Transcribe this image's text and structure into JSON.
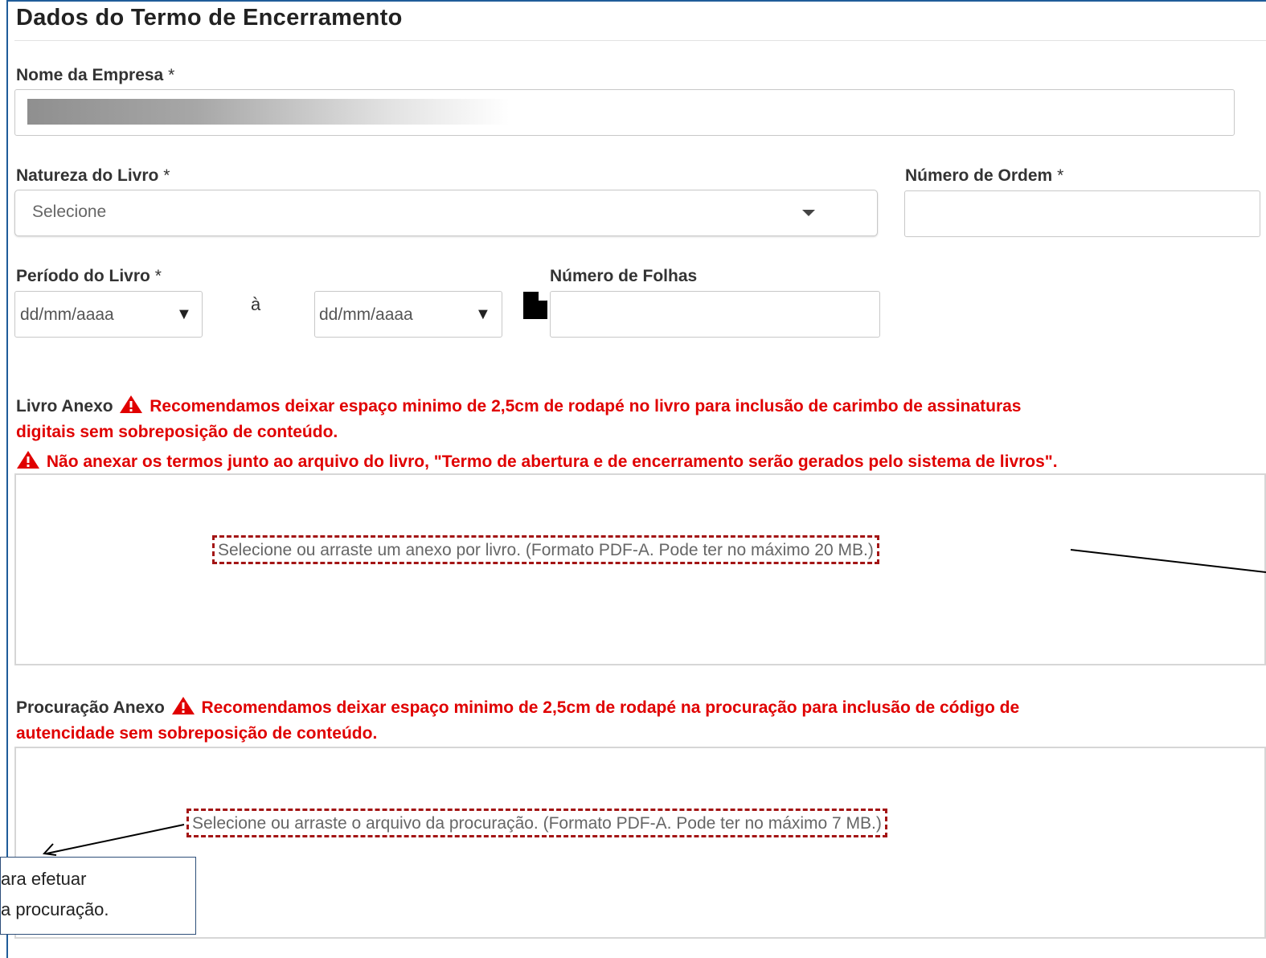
{
  "section": {
    "title": "Dados do Termo de Encerramento"
  },
  "company": {
    "label": "Nome da Empresa",
    "required_mark": "*",
    "value": ""
  },
  "nature": {
    "label": "Natureza do Livro",
    "required_mark": "*",
    "selected": "Selecione"
  },
  "order": {
    "label": "Número de Ordem",
    "required_mark": "*",
    "value": ""
  },
  "period": {
    "label": "Período do Livro",
    "required_mark": "*",
    "start_placeholder": "dd/mm/aaaa",
    "separator": "à",
    "end_placeholder": "dd/mm/aaaa",
    "caret": "▼"
  },
  "pages": {
    "label": "Número de Folhas",
    "value": ""
  },
  "book_attachment": {
    "label": "Livro Anexo",
    "warning_1_line_1": "Recomendamos deixar espaço minimo de 2,5cm de rodapé no livro para inclusão de carimbo de assinaturas",
    "warning_1_line_2": "digitais sem sobreposição de conteúdo.",
    "warning_2": "Não anexar os termos junto ao arquivo do livro, \"Termo de abertura e de encerramento serão gerados pelo sistema de livros\".",
    "drop_text": "Selecione ou arraste um anexo por livro. (Formato PDF-A. Pode ter no máximo 20 MB.)"
  },
  "proxy_attachment": {
    "label": "Procuração Anexo",
    "warning_line_1": "Recomendamos deixar espaço minimo de 2,5cm de rodapé na procuração para inclusão de código de",
    "warning_line_2": "autencidade sem sobreposição de conteúdo.",
    "drop_text": "Selecione ou arraste o arquivo da procuração. (Formato PDF-A. Pode ter no máximo 7 MB.)"
  },
  "callout": {
    "line_1": "ara efetuar",
    "line_2": "a procuração."
  },
  "colors": {
    "warning": "#e00000",
    "frame": "#1f5c99",
    "dashed_highlight": "#a31515"
  },
  "icons": {
    "warning": "warning-triangle-icon",
    "file": "file-icon",
    "dropdown": "caret-down-icon"
  }
}
